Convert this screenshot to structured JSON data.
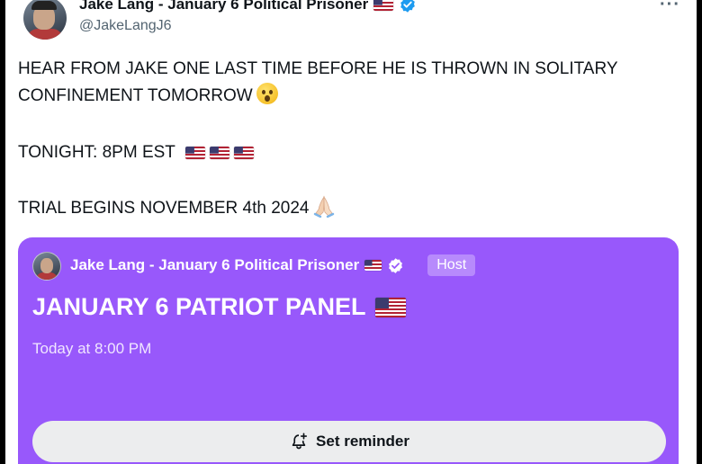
{
  "tweet": {
    "author": {
      "display_name": "Jake Lang - January 6 Political Prisoner",
      "handle": "@JakeLangJ6",
      "flag_icon": "us-flag-icon",
      "verified_icon": "verified-badge-icon"
    },
    "more_icon": "more-options-icon",
    "lines": {
      "line1": "HEAR FROM JAKE ONE LAST TIME BEFORE HE IS THROWN IN SOLITARY",
      "line2": "CONFINEMENT TOMORROW",
      "line3": "TONIGHT: 8PM EST",
      "line4": "TRIAL BEGINS NOVEMBER 4th 2024"
    },
    "emojis": {
      "line2": "astonished-face-emoji",
      "line3": "us-flag-emoji x3",
      "line4": "folded-hands-emoji"
    }
  },
  "space_card": {
    "host_name": "Jake Lang - January 6 Political Prisoner",
    "host_badge": "Host",
    "title": "JANUARY 6 PATRIOT PANEL",
    "time": "Today at 8:00 PM",
    "button_label": "Set reminder",
    "button_icon": "bell-plus-icon",
    "colors": {
      "card_background": "#9858fb",
      "button_background": "#ecedee"
    }
  }
}
